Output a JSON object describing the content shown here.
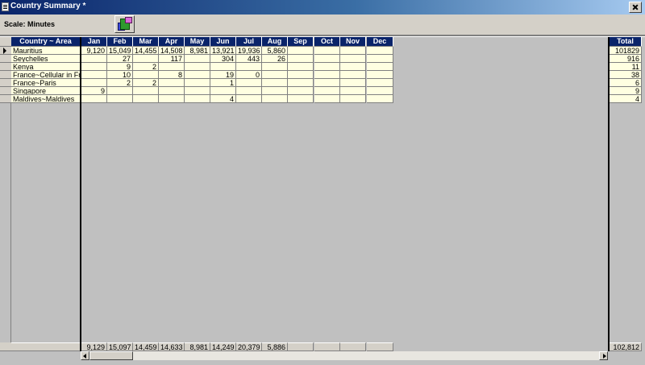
{
  "window": {
    "title": "Country Summary *"
  },
  "toolbar": {
    "scale_label": "Scale: Minutes",
    "chart_button_icon": "chart-cube-icon"
  },
  "grid": {
    "columns": {
      "name": "Country ~ Area",
      "months": [
        "Jan",
        "Feb",
        "Mar",
        "Apr",
        "May",
        "Jun",
        "Jul",
        "Aug",
        "Sep",
        "Oct",
        "Nov",
        "Dec"
      ],
      "total": "Total"
    },
    "rows": [
      {
        "name": "Mauritius",
        "values": [
          "9,120",
          "15,049",
          "14,455",
          "14,508",
          "8,981",
          "13,921",
          "19,936",
          "5,860",
          "",
          "",
          "",
          ""
        ],
        "total": "101829"
      },
      {
        "name": "Seychelles",
        "values": [
          "",
          "27",
          "",
          "117",
          "",
          "304",
          "443",
          "26",
          "",
          "",
          "",
          ""
        ],
        "total": "916"
      },
      {
        "name": "Kenya",
        "values": [
          "",
          "9",
          "2",
          "",
          "",
          "",
          "",
          "",
          "",
          "",
          "",
          ""
        ],
        "total": "11"
      },
      {
        "name": "France~Cellular in France",
        "values": [
          "",
          "10",
          "",
          "8",
          "",
          "19",
          "0",
          "",
          "",
          "",
          "",
          ""
        ],
        "total": "38"
      },
      {
        "name": "France~Paris",
        "values": [
          "",
          "2",
          "2",
          "",
          "",
          "1",
          "",
          "",
          "",
          "",
          "",
          ""
        ],
        "total": "6"
      },
      {
        "name": "Singapore",
        "values": [
          "9",
          "",
          "",
          "",
          "",
          "",
          "",
          "",
          "",
          "",
          "",
          ""
        ],
        "total": "9"
      },
      {
        "name": "Maldives~Maldives",
        "values": [
          "",
          "",
          "",
          "",
          "",
          "4",
          "",
          "",
          "",
          "",
          "",
          ""
        ],
        "total": "4"
      }
    ],
    "totals": {
      "name": "",
      "values": [
        "9,129",
        "15,097",
        "14,459",
        "14,633",
        "8,981",
        "14,249",
        "20,379",
        "5,886",
        "",
        "",
        "",
        ""
      ],
      "total": "102,812"
    }
  },
  "colors": {
    "header_bg": "#0a246a",
    "header_text": "#ffffff",
    "cell_bg": "#ffffe1",
    "panel_bg": "#c0c0c0"
  }
}
